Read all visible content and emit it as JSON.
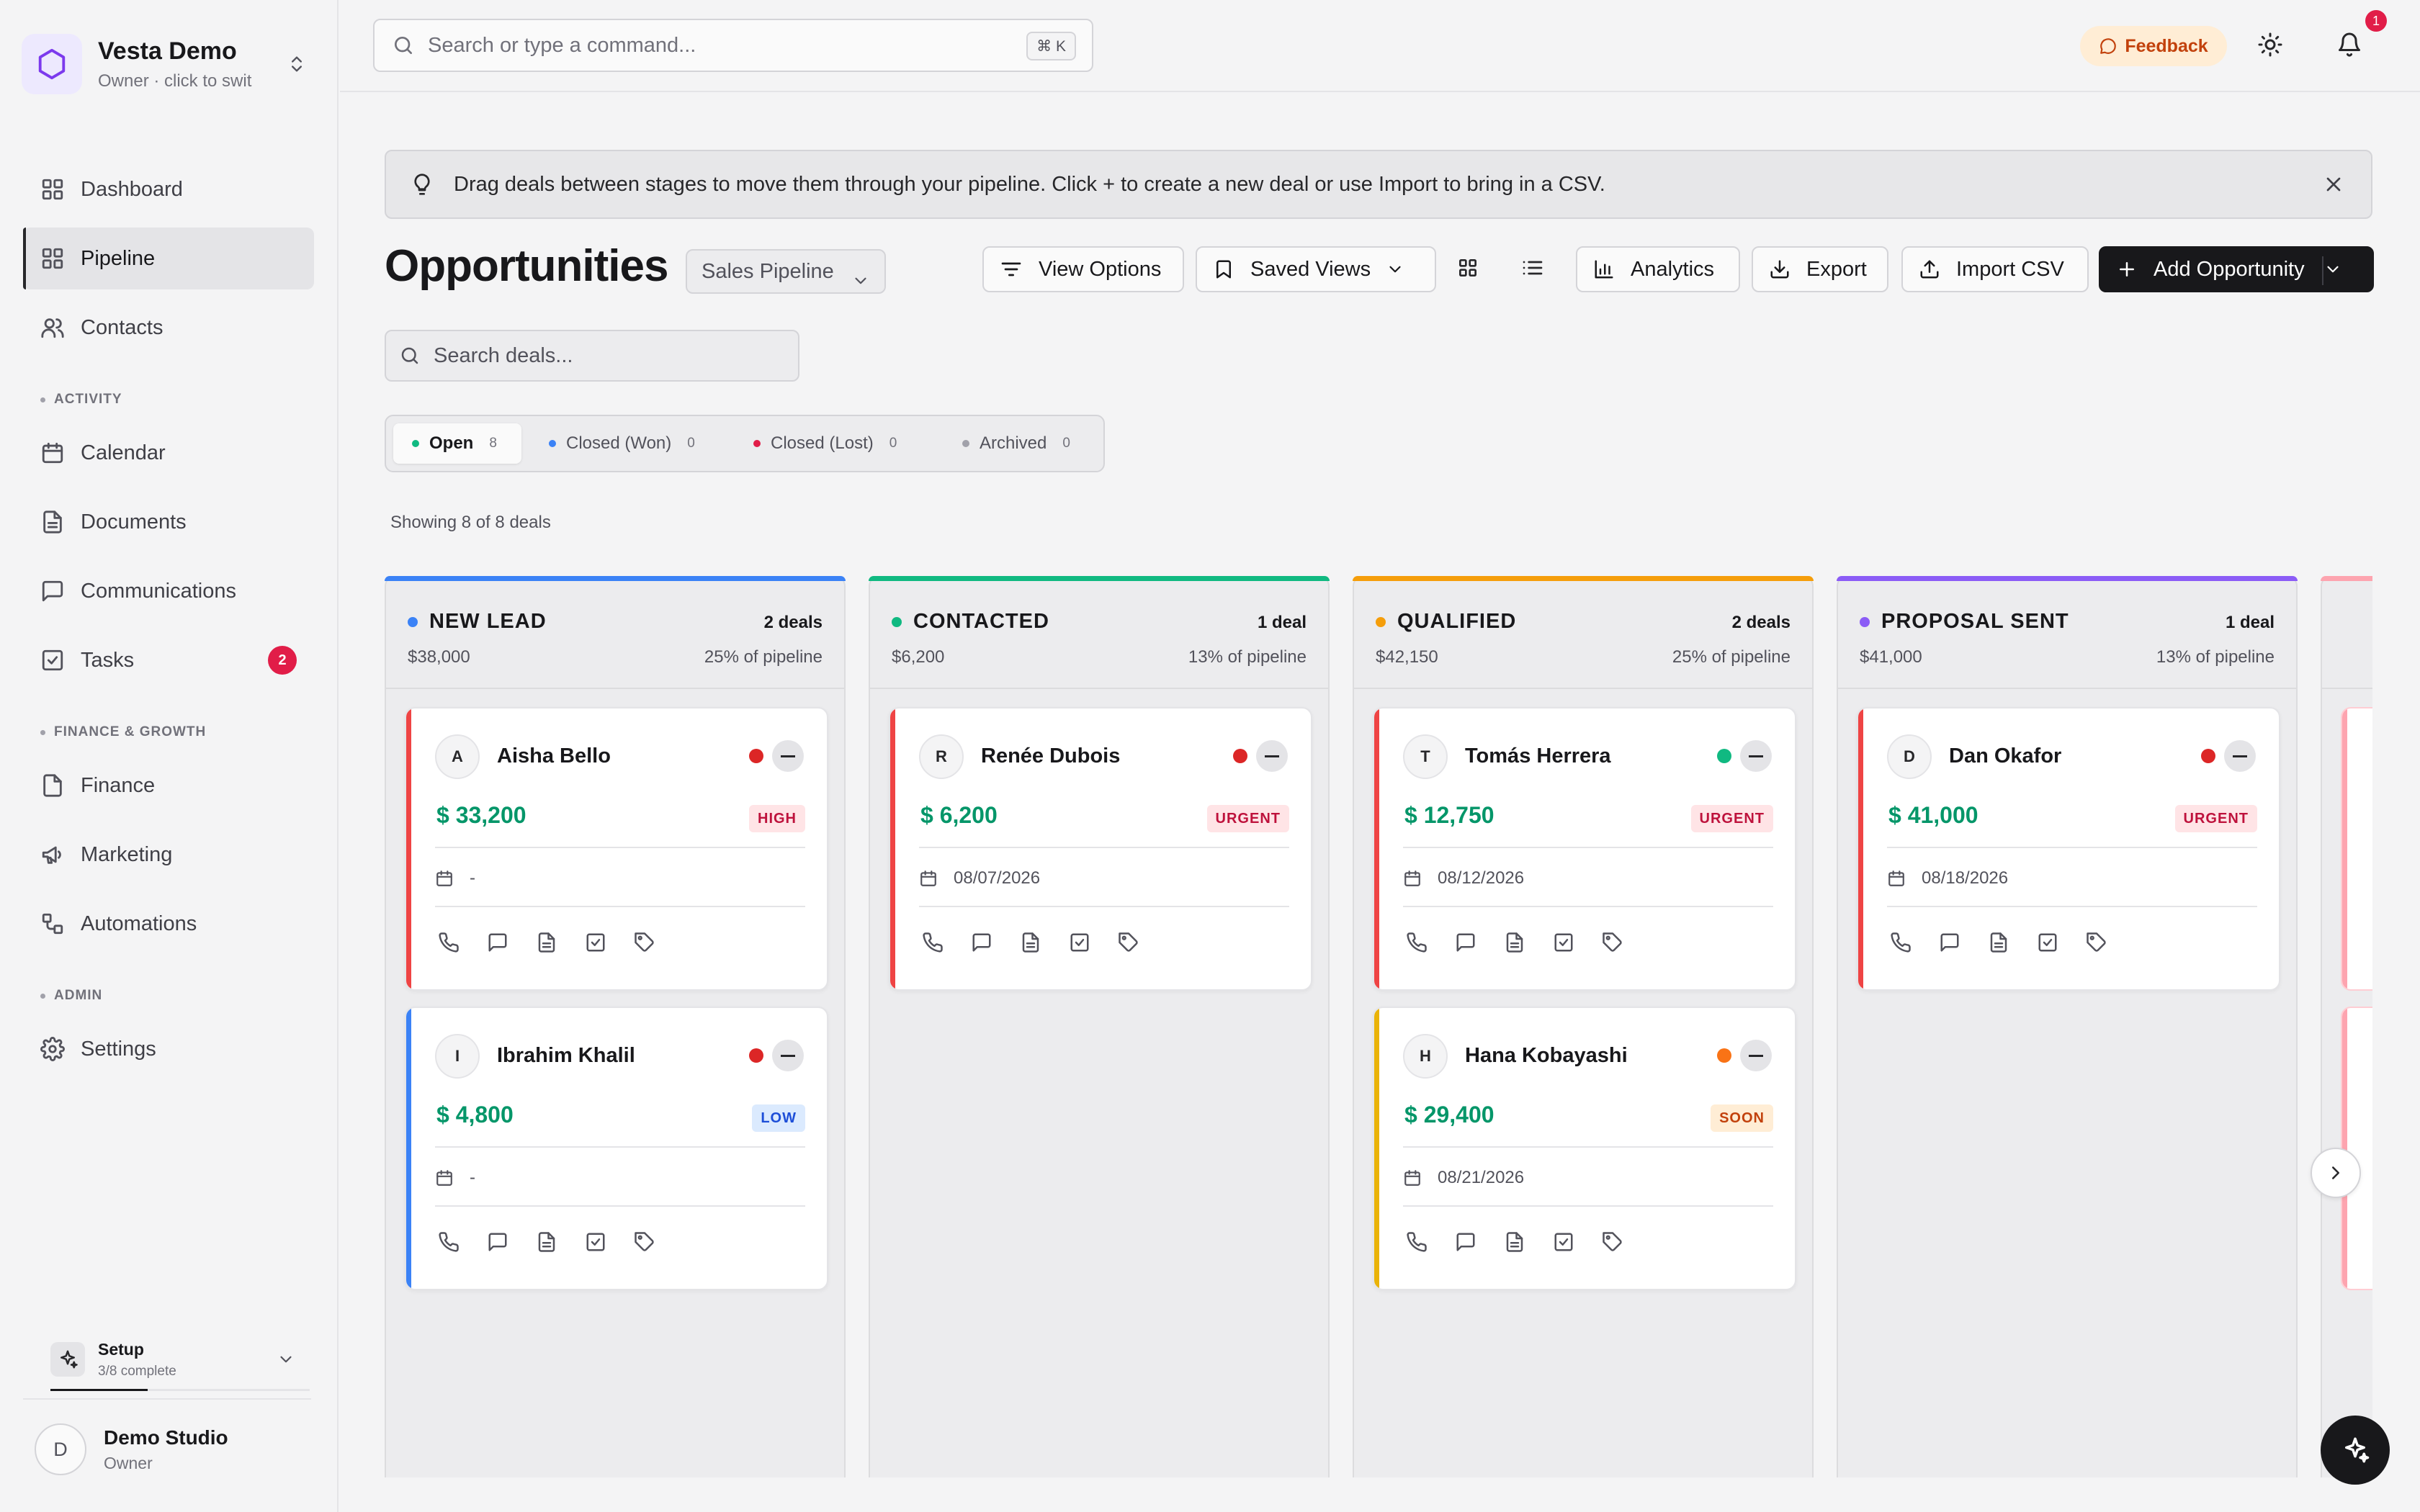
{
  "workspace": {
    "name": "Vesta Demo",
    "subtitle": "Owner · click to swit"
  },
  "sidebar": {
    "items": [
      {
        "label": "Dashboard",
        "icon": "layout-grid-icon"
      },
      {
        "label": "Pipeline",
        "icon": "layout-grid-icon",
        "active": true
      },
      {
        "label": "Contacts",
        "icon": "users-icon"
      },
      {
        "label": "Calendar",
        "icon": "calendar-icon"
      },
      {
        "label": "Documents",
        "icon": "file-icon"
      },
      {
        "label": "Communications",
        "icon": "message-icon"
      },
      {
        "label": "Tasks",
        "icon": "checkbox-icon",
        "badge": "2"
      },
      {
        "label": "Finance",
        "icon": "file-icon"
      },
      {
        "label": "Marketing",
        "icon": "megaphone-icon"
      },
      {
        "label": "Automations",
        "icon": "workflow-icon"
      },
      {
        "label": "Settings",
        "icon": "gear-icon"
      }
    ],
    "sections": {
      "activity": "ACTIVITY",
      "finance": "FINANCE & GROWTH",
      "admin": "ADMIN"
    },
    "setup": {
      "title": "Setup",
      "progress_text": "3/8 complete",
      "progress": 0.375
    },
    "user": {
      "initial": "D",
      "name": "Demo Studio",
      "role": "Owner"
    }
  },
  "topbar": {
    "search_placeholder": "Search or type a command...",
    "shortcut": "⌘ K",
    "feedback_label": "Feedback",
    "notification_count": "1"
  },
  "tip": {
    "text": "Drag deals between stages to move them through your pipeline. Click + to create a new deal or use Import to bring in a CSV."
  },
  "header": {
    "title": "Opportunities",
    "pipeline_select": "Sales Pipeline",
    "view_options": "View Options",
    "saved_views": "Saved Views",
    "analytics": "Analytics",
    "export": "Export",
    "import_csv": "Import CSV",
    "add_opportunity": "Add Opportunity"
  },
  "deal_search": {
    "placeholder": "Search deals..."
  },
  "status_tabs": [
    {
      "label": "Open",
      "count": "8",
      "color": "#10b981",
      "active": true
    },
    {
      "label": "Closed (Won)",
      "count": "0",
      "color": "#3b82f6"
    },
    {
      "label": "Closed (Lost)",
      "count": "0",
      "color": "#e11d48"
    },
    {
      "label": "Archived",
      "count": "0",
      "color": "#a1a1aa"
    }
  ],
  "showing_text": "Showing 8 of 8 deals",
  "columns": [
    {
      "name": "NEW LEAD",
      "color": "#3b82f6",
      "count": "2 deals",
      "total": "$38,000",
      "pct": "25% of pipeline",
      "cards": [
        {
          "initial": "A",
          "name": "Aisha Bello",
          "amount": "$ 33,200",
          "tag": "HIGH",
          "date": "-",
          "bar": "#ef4444",
          "dot": "#dc2626"
        },
        {
          "initial": "I",
          "name": "Ibrahim Khalil",
          "amount": "$ 4,800",
          "tag": "LOW",
          "date": "-",
          "bar": "#3b82f6",
          "dot": "#dc2626"
        }
      ]
    },
    {
      "name": "CONTACTED",
      "color": "#10b981",
      "count": "1 deal",
      "total": "$6,200",
      "pct": "13% of pipeline",
      "cards": [
        {
          "initial": "R",
          "name": "Renée Dubois",
          "amount": "$ 6,200",
          "tag": "URGENT",
          "date": "08/07/2026",
          "bar": "#ef4444",
          "dot": "#dc2626"
        }
      ]
    },
    {
      "name": "QUALIFIED",
      "color": "#f59e0b",
      "count": "2 deals",
      "total": "$42,150",
      "pct": "25% of pipeline",
      "cards": [
        {
          "initial": "T",
          "name": "Tomás Herrera",
          "amount": "$ 12,750",
          "tag": "URGENT",
          "date": "08/12/2026",
          "bar": "#ef4444",
          "dot": "#10b981"
        },
        {
          "initial": "H",
          "name": "Hana Kobayashi",
          "amount": "$ 29,400",
          "tag": "SOON",
          "date": "08/21/2026",
          "bar": "#eab308",
          "dot": "#f97316"
        }
      ]
    },
    {
      "name": "PROPOSAL SENT",
      "color": "#8b5cf6",
      "count": "1 deal",
      "total": "$41,000",
      "pct": "13% of pipeline",
      "cards": [
        {
          "initial": "D",
          "name": "Dan Okafor",
          "amount": "$ 41,000",
          "tag": "URGENT",
          "date": "08/18/2026",
          "bar": "#ef4444",
          "dot": "#dc2626"
        }
      ]
    }
  ]
}
